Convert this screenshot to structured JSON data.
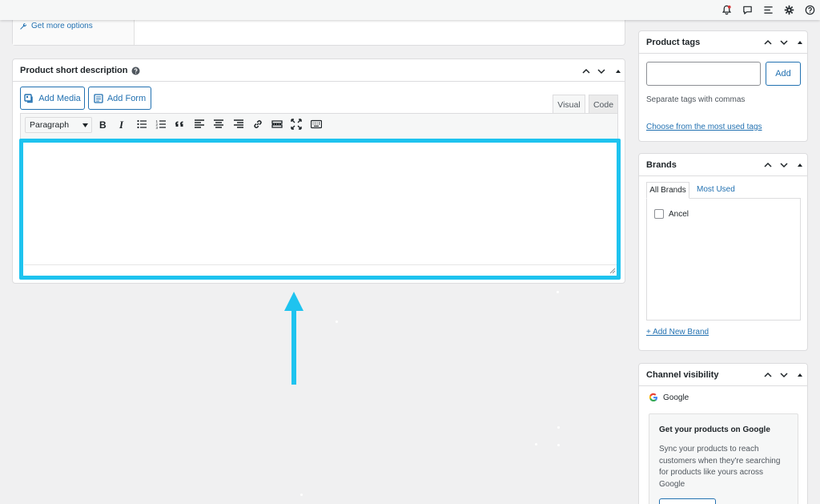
{
  "top_card": {
    "get_more_options": "Get more options"
  },
  "short_description": {
    "title": "Product short description",
    "add_media": "Add Media",
    "add_form": "Add Form",
    "tab_visual": "Visual",
    "tab_code": "Code",
    "format_select": "Paragraph",
    "highlight_color": "#1ec3ef"
  },
  "product_tags": {
    "title": "Product tags",
    "input_value": "",
    "add_button": "Add",
    "hint": "Separate tags with commas",
    "choose_link": "Choose from the most used tags"
  },
  "brands": {
    "title": "Brands",
    "tabs": [
      "All Brands",
      "Most Used"
    ],
    "items": [
      {
        "label": "Ancel",
        "checked": false
      }
    ],
    "add_link": "+ Add New Brand"
  },
  "channel_visibility": {
    "title": "Channel visibility",
    "channel": "Google",
    "promo_title": "Get your products on Google",
    "promo_text": "Sync your products to reach customers when they're searching for products like yours across Google"
  },
  "colors": {
    "accent": "#2271b1",
    "highlight": "#1ec3ef",
    "background": "#f0f0f1"
  }
}
